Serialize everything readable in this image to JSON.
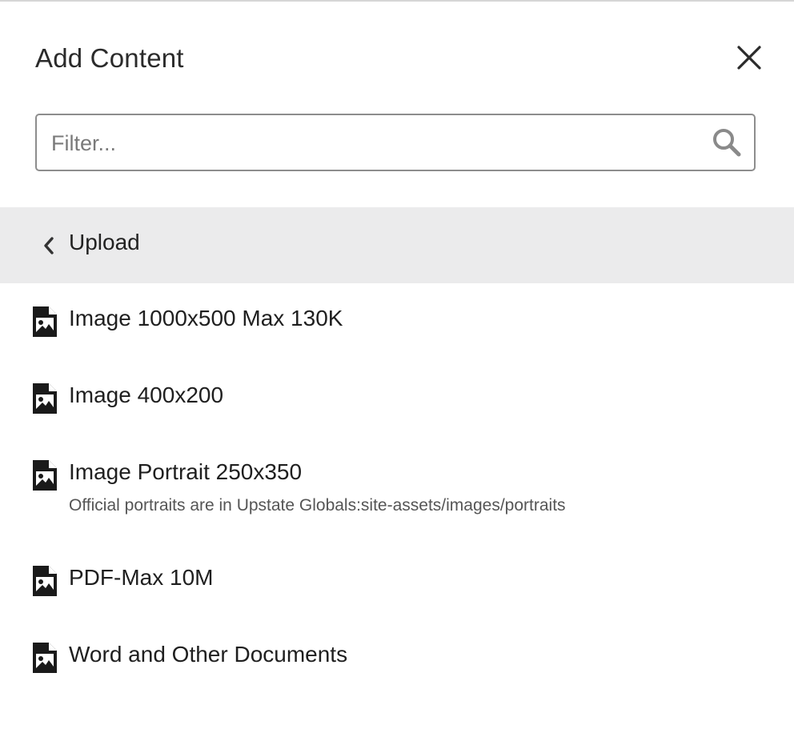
{
  "header": {
    "title": "Add Content",
    "close_icon": "close-icon"
  },
  "filter": {
    "placeholder": "Filter...",
    "value": "",
    "icon": "search-icon"
  },
  "upload": {
    "label": "Upload",
    "icon": "chevron-left-icon"
  },
  "items": [
    {
      "label": "Image 1000x500 Max 130K",
      "description": "",
      "icon": "file-image-icon"
    },
    {
      "label": "Image 400x200",
      "description": "",
      "icon": "file-image-icon"
    },
    {
      "label": "Image Portrait 250x350",
      "description": "Official portraits are in Upstate Globals:site-assets/images/portraits",
      "icon": "file-image-icon"
    },
    {
      "label": "PDF-Max 10M",
      "description": "",
      "icon": "file-image-icon"
    },
    {
      "label": "Word and Other Documents",
      "description": "",
      "icon": "file-image-icon"
    }
  ],
  "colors": {
    "upload_bar_bg": "#ebebec",
    "border": "#8d8d8d",
    "text": "#222222"
  }
}
